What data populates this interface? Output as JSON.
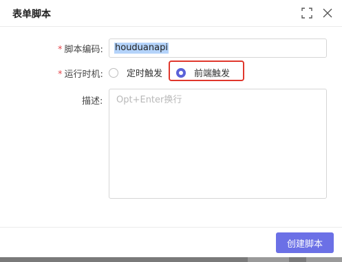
{
  "dialog": {
    "title": "表单脚本",
    "maximize_icon": "fullscreen-icon",
    "close_icon": "close-icon"
  },
  "form": {
    "script_code": {
      "required_mark": "*",
      "label": "脚本编码:",
      "value": "houduanapi"
    },
    "trigger_time": {
      "required_mark": "*",
      "label": "运行时机:",
      "options": [
        {
          "label": "定时触发",
          "selected": false
        },
        {
          "label": "前端触发",
          "selected": true
        }
      ],
      "highlight_color": "#e0362b"
    },
    "description": {
      "label": "描述:",
      "placeholder": "Opt+Enter换行",
      "value": ""
    }
  },
  "footer": {
    "create_label": "创建脚本",
    "button_color": "#6b70e6"
  }
}
